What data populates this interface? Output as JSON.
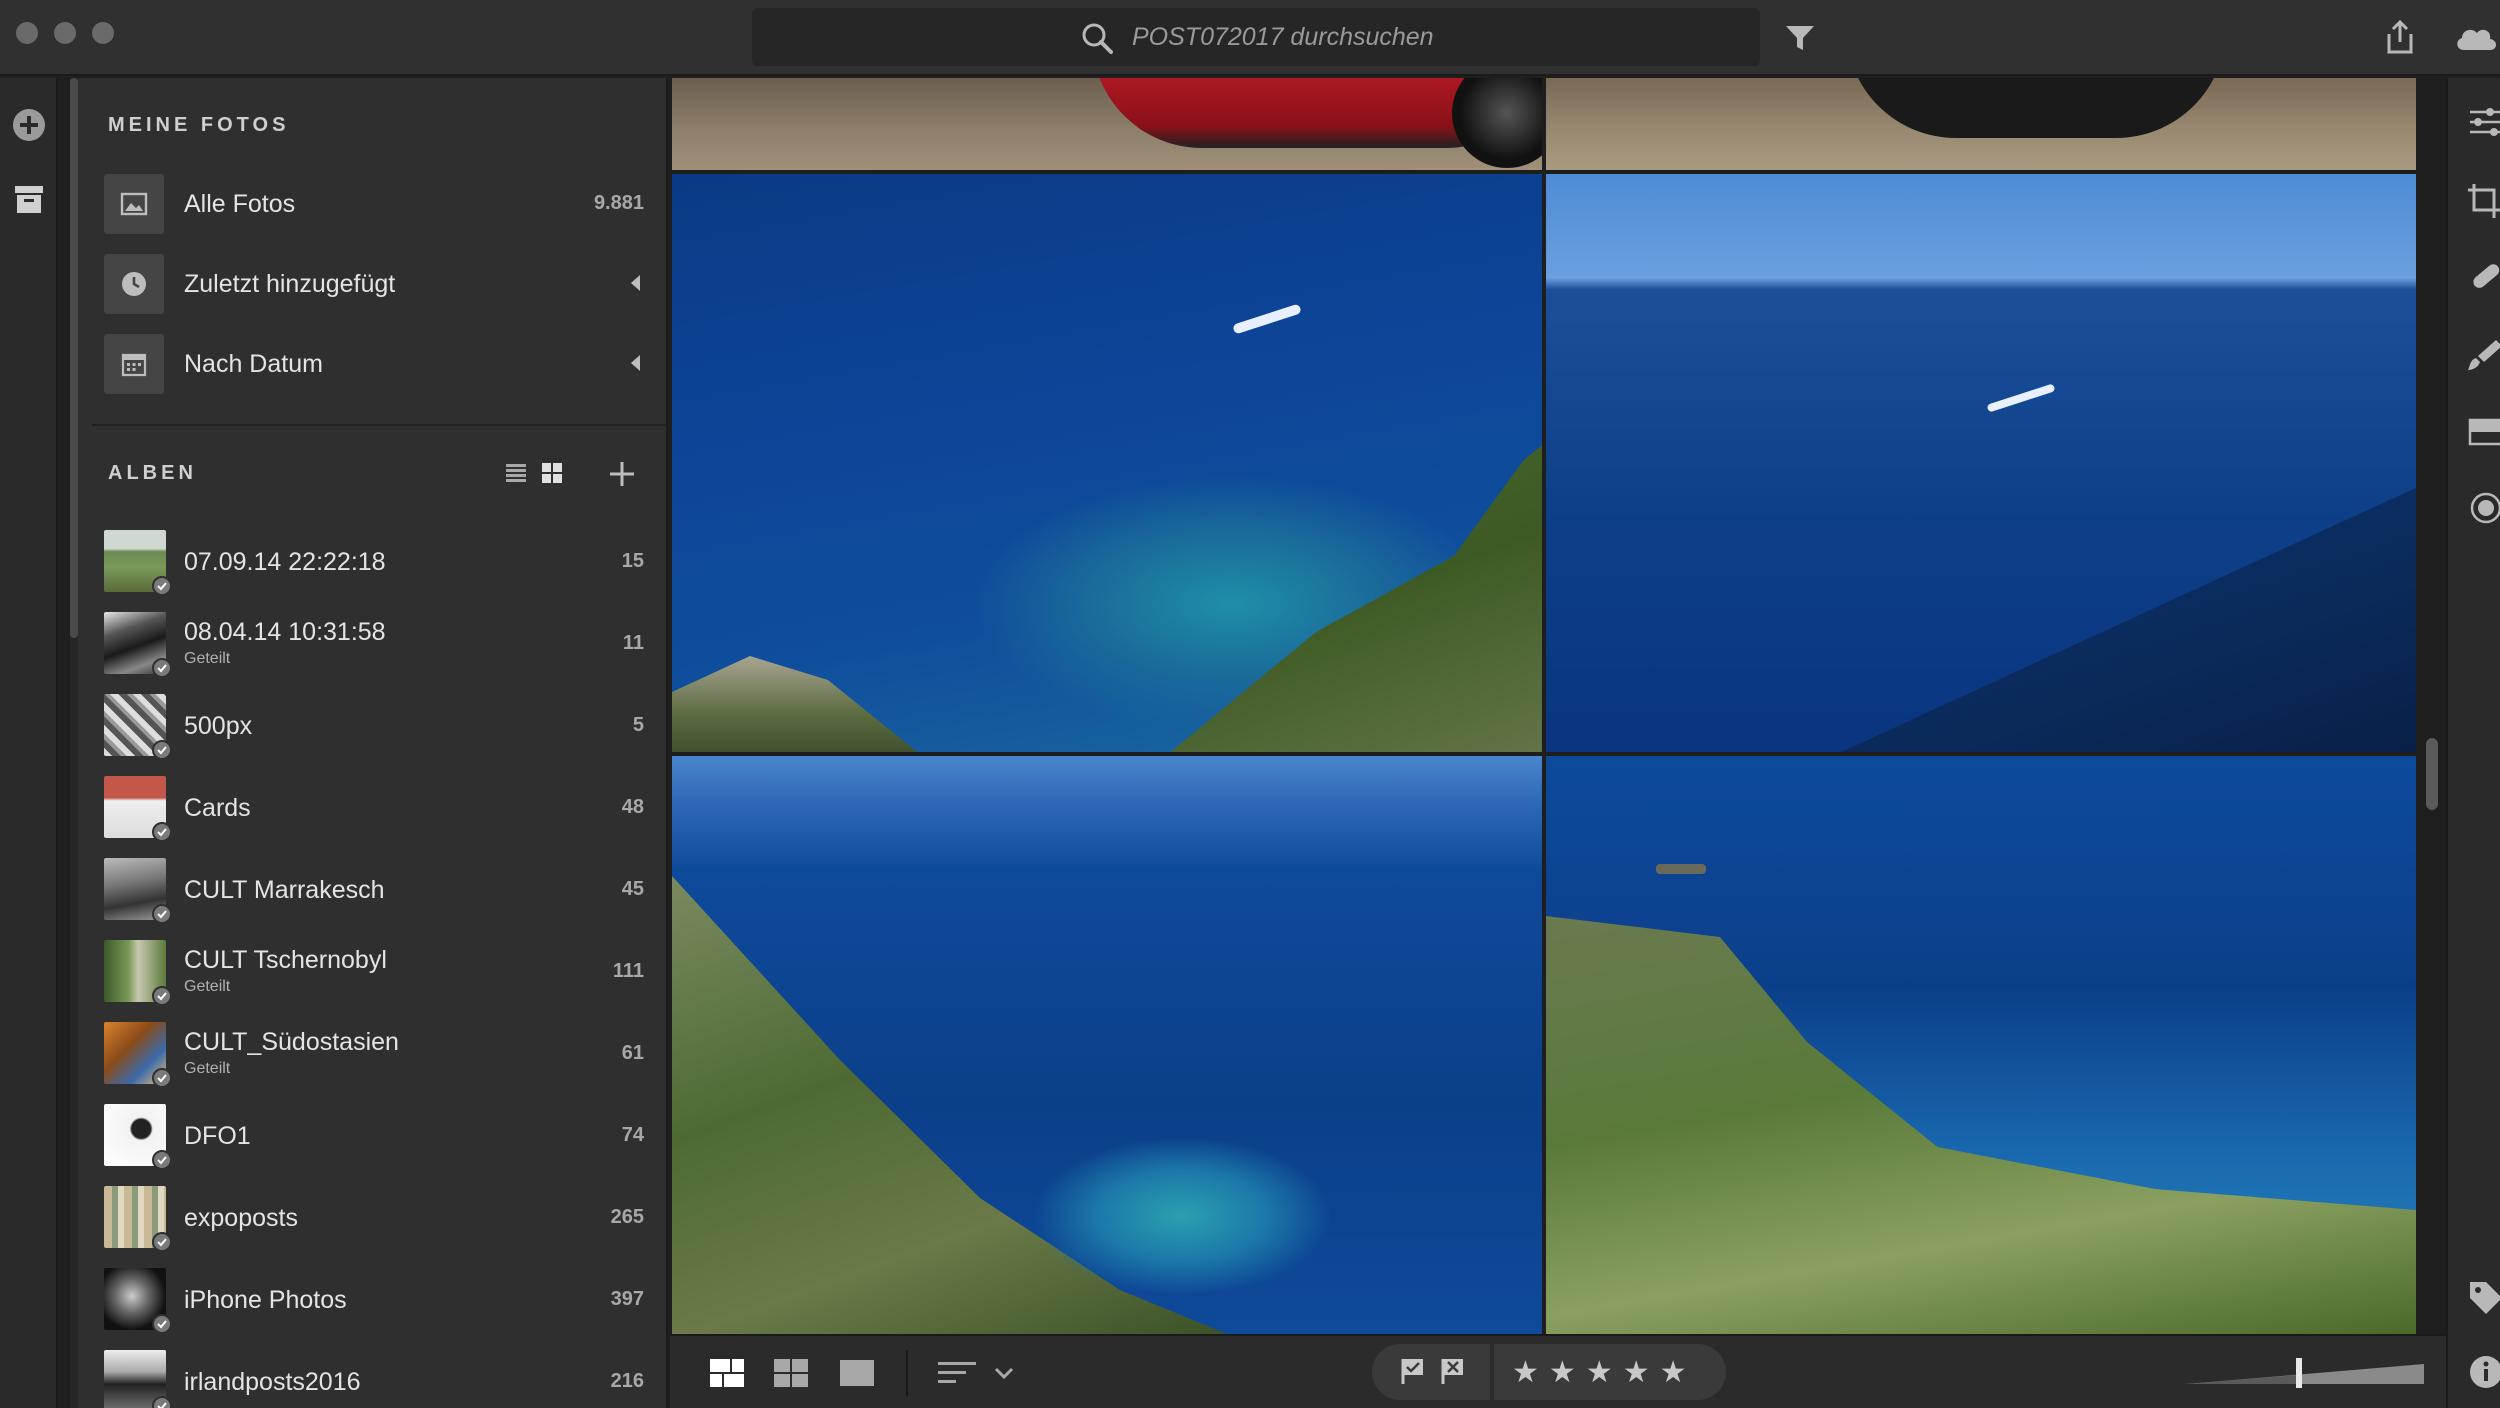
{
  "search": {
    "placeholder": "POST072017 durchsuchen"
  },
  "sidebar": {
    "meine_fotos": {
      "title": "MEINE FOTOS",
      "items": [
        {
          "label": "Alle Fotos",
          "count": "9.881",
          "icon": "image-icon"
        },
        {
          "label": "Zuletzt hinzugefügt",
          "icon": "clock-icon"
        },
        {
          "label": "Nach Datum",
          "icon": "calendar-icon"
        }
      ]
    },
    "alben": {
      "title": "ALBEN",
      "items": [
        {
          "label": "07.09.14 22:22:18",
          "count": "15"
        },
        {
          "label": "08.04.14 10:31:58",
          "sub": "Geteilt",
          "count": "11"
        },
        {
          "label": "500px",
          "count": "5"
        },
        {
          "label": "Cards",
          "count": "48"
        },
        {
          "label": "CULT Marrakesch",
          "count": "45"
        },
        {
          "label": "CULT Tschernobyl",
          "sub": "Geteilt",
          "count": "111"
        },
        {
          "label": "CULT_Südostasien",
          "sub": "Geteilt",
          "count": "61"
        },
        {
          "label": "DFO1",
          "count": "74"
        },
        {
          "label": "expoposts",
          "count": "265"
        },
        {
          "label": "iPhone Photos",
          "count": "397"
        },
        {
          "label": "irlandposts2016",
          "count": "216"
        }
      ]
    }
  },
  "bottombar": {
    "rating_stars": 5
  },
  "colors": {
    "accent": "#2f5fb0",
    "panel": "#2f2f2f",
    "sea": "#0d3f88"
  }
}
